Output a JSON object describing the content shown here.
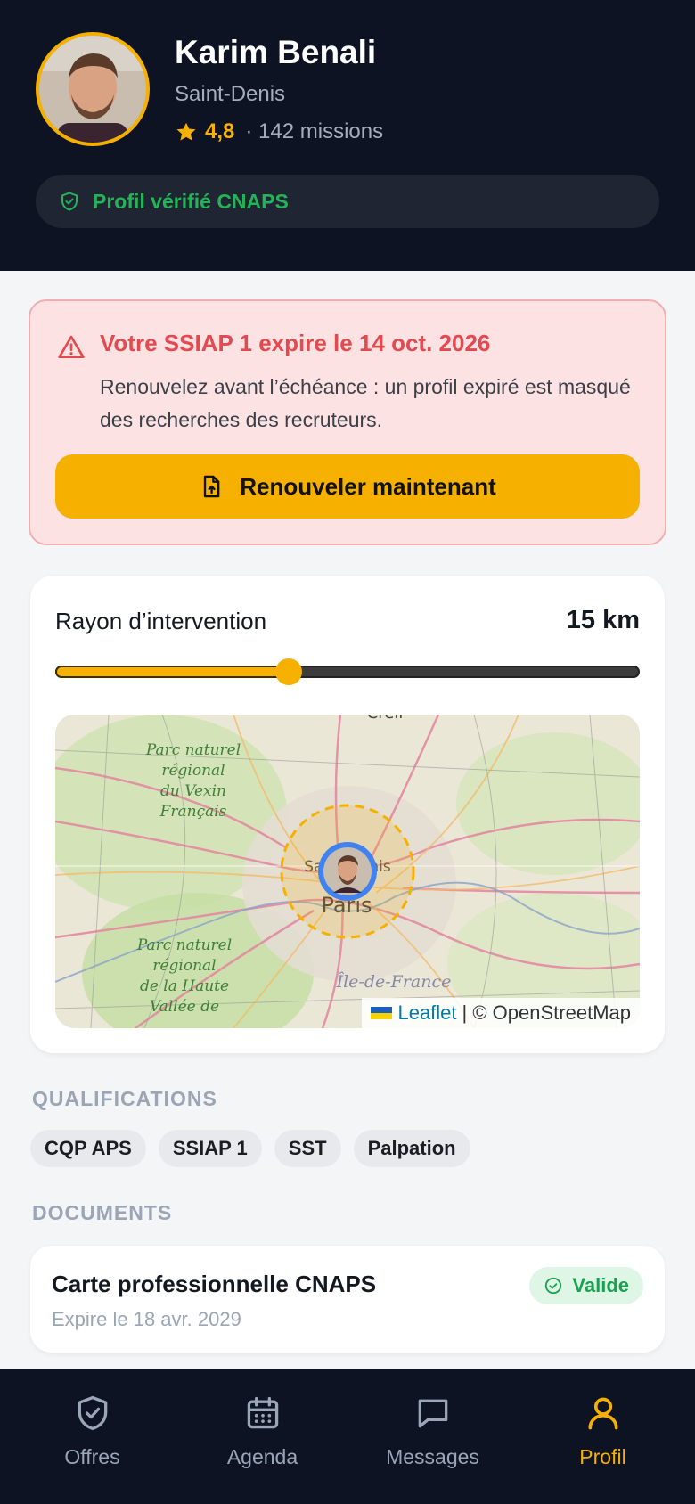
{
  "profile": {
    "name": "Karim Benali",
    "city": "Saint-Denis",
    "rating": "4,8",
    "missions": "· 142 missions",
    "verified_label": "Profil vérifié CNAPS"
  },
  "alert": {
    "title": "Votre SSIAP 1 expire le 14 oct. 2026",
    "body": "Renouvelez avant l’échéance : un profil expiré est masqué des recherches des recruteurs.",
    "button_label": "Renouveler maintenant"
  },
  "radius": {
    "label": "Rayon d’intervention",
    "value": "15 km",
    "slider_fraction": 0.4
  },
  "map": {
    "labels": {
      "parc1": [
        "Parc naturel",
        "régional",
        "du Vexin",
        "Français"
      ],
      "parc2": [
        "Parc naturel",
        "régional",
        "de la Haute",
        "Vallée de"
      ],
      "paris": "Paris",
      "saint_denis": "Saint-Denis",
      "ile_de_france": "Île-de-France",
      "creil": "Creil"
    },
    "attribution_leaflet": "Leaflet",
    "attribution_rest": "| © OpenStreetMap"
  },
  "qualifications": {
    "heading": "QUALIFICATIONS",
    "items": [
      "CQP APS",
      "SSIAP 1",
      "SST",
      "Palpation"
    ]
  },
  "documents": {
    "heading": "DOCUMENTS",
    "items": [
      {
        "title": "Carte professionnelle CNAPS",
        "expiry": "Expire le 18 avr. 2029",
        "status": "Valide"
      }
    ]
  },
  "tabs": [
    {
      "label": "Offres",
      "icon": "shield-check-icon",
      "active": false
    },
    {
      "label": "Agenda",
      "icon": "calendar-icon",
      "active": false
    },
    {
      "label": "Messages",
      "icon": "message-icon",
      "active": false
    },
    {
      "label": "Profil",
      "icon": "user-icon",
      "active": true
    }
  ],
  "colors": {
    "header_bg": "#0d1322",
    "accent": "#f5b000",
    "success": "#22b457",
    "danger": "#e24a4f"
  }
}
